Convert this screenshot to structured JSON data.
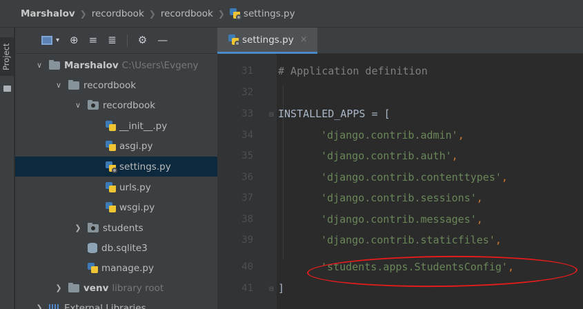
{
  "breadcrumb": {
    "items": [
      "Marshalov",
      "recordbook",
      "recordbook",
      "settings.py"
    ]
  },
  "side_strip": {
    "project_label": "Project"
  },
  "toolbar": {
    "icons": [
      "project-view-icon",
      "dropdown-icon",
      "locate-icon",
      "expand-all-icon",
      "collapse-all-icon",
      "gear-icon",
      "hide-icon"
    ]
  },
  "tree": {
    "rows": [
      {
        "label": "Marshalov",
        "suffix": "C:\\Users\\Evgeny"
      },
      {
        "label": "recordbook"
      },
      {
        "label": "recordbook"
      },
      {
        "label": "__init__.py"
      },
      {
        "label": "asgi.py"
      },
      {
        "label": "settings.py"
      },
      {
        "label": "urls.py"
      },
      {
        "label": "wsgi.py"
      },
      {
        "label": "students"
      },
      {
        "label": "db.sqlite3"
      },
      {
        "label": "manage.py"
      },
      {
        "label": "venv",
        "suffix": "library root"
      },
      {
        "label": "External Libraries"
      }
    ],
    "selected": "settings.py"
  },
  "editor": {
    "tab": {
      "label": "settings.py",
      "close": "×"
    },
    "lines": [
      {
        "num": "31",
        "text": "# Application definition"
      },
      {
        "num": "32",
        "text": ""
      },
      {
        "num": "33",
        "name_part": "INSTALLED_APPS = ["
      },
      {
        "num": "34",
        "str": "'django.contrib.admin'",
        "comma": ","
      },
      {
        "num": "35",
        "str": "'django.contrib.auth'",
        "comma": ","
      },
      {
        "num": "36",
        "str": "'django.contrib.contenttypes'",
        "comma": ","
      },
      {
        "num": "37",
        "str": "'django.contrib.sessions'",
        "comma": ","
      },
      {
        "num": "38",
        "str": "'django.contrib.messages'",
        "comma": ","
      },
      {
        "num": "39",
        "str": "'django.contrib.staticfiles'",
        "comma": ","
      },
      {
        "num": "40",
        "str": "'students.apps.StudentsConfig'",
        "comma": ","
      },
      {
        "num": "41",
        "close_part": "]"
      }
    ]
  },
  "colors": {
    "annotation": "#e31c1c",
    "selection": "#0d293e",
    "string": "#6a8759",
    "keyword": "#cc7832"
  }
}
